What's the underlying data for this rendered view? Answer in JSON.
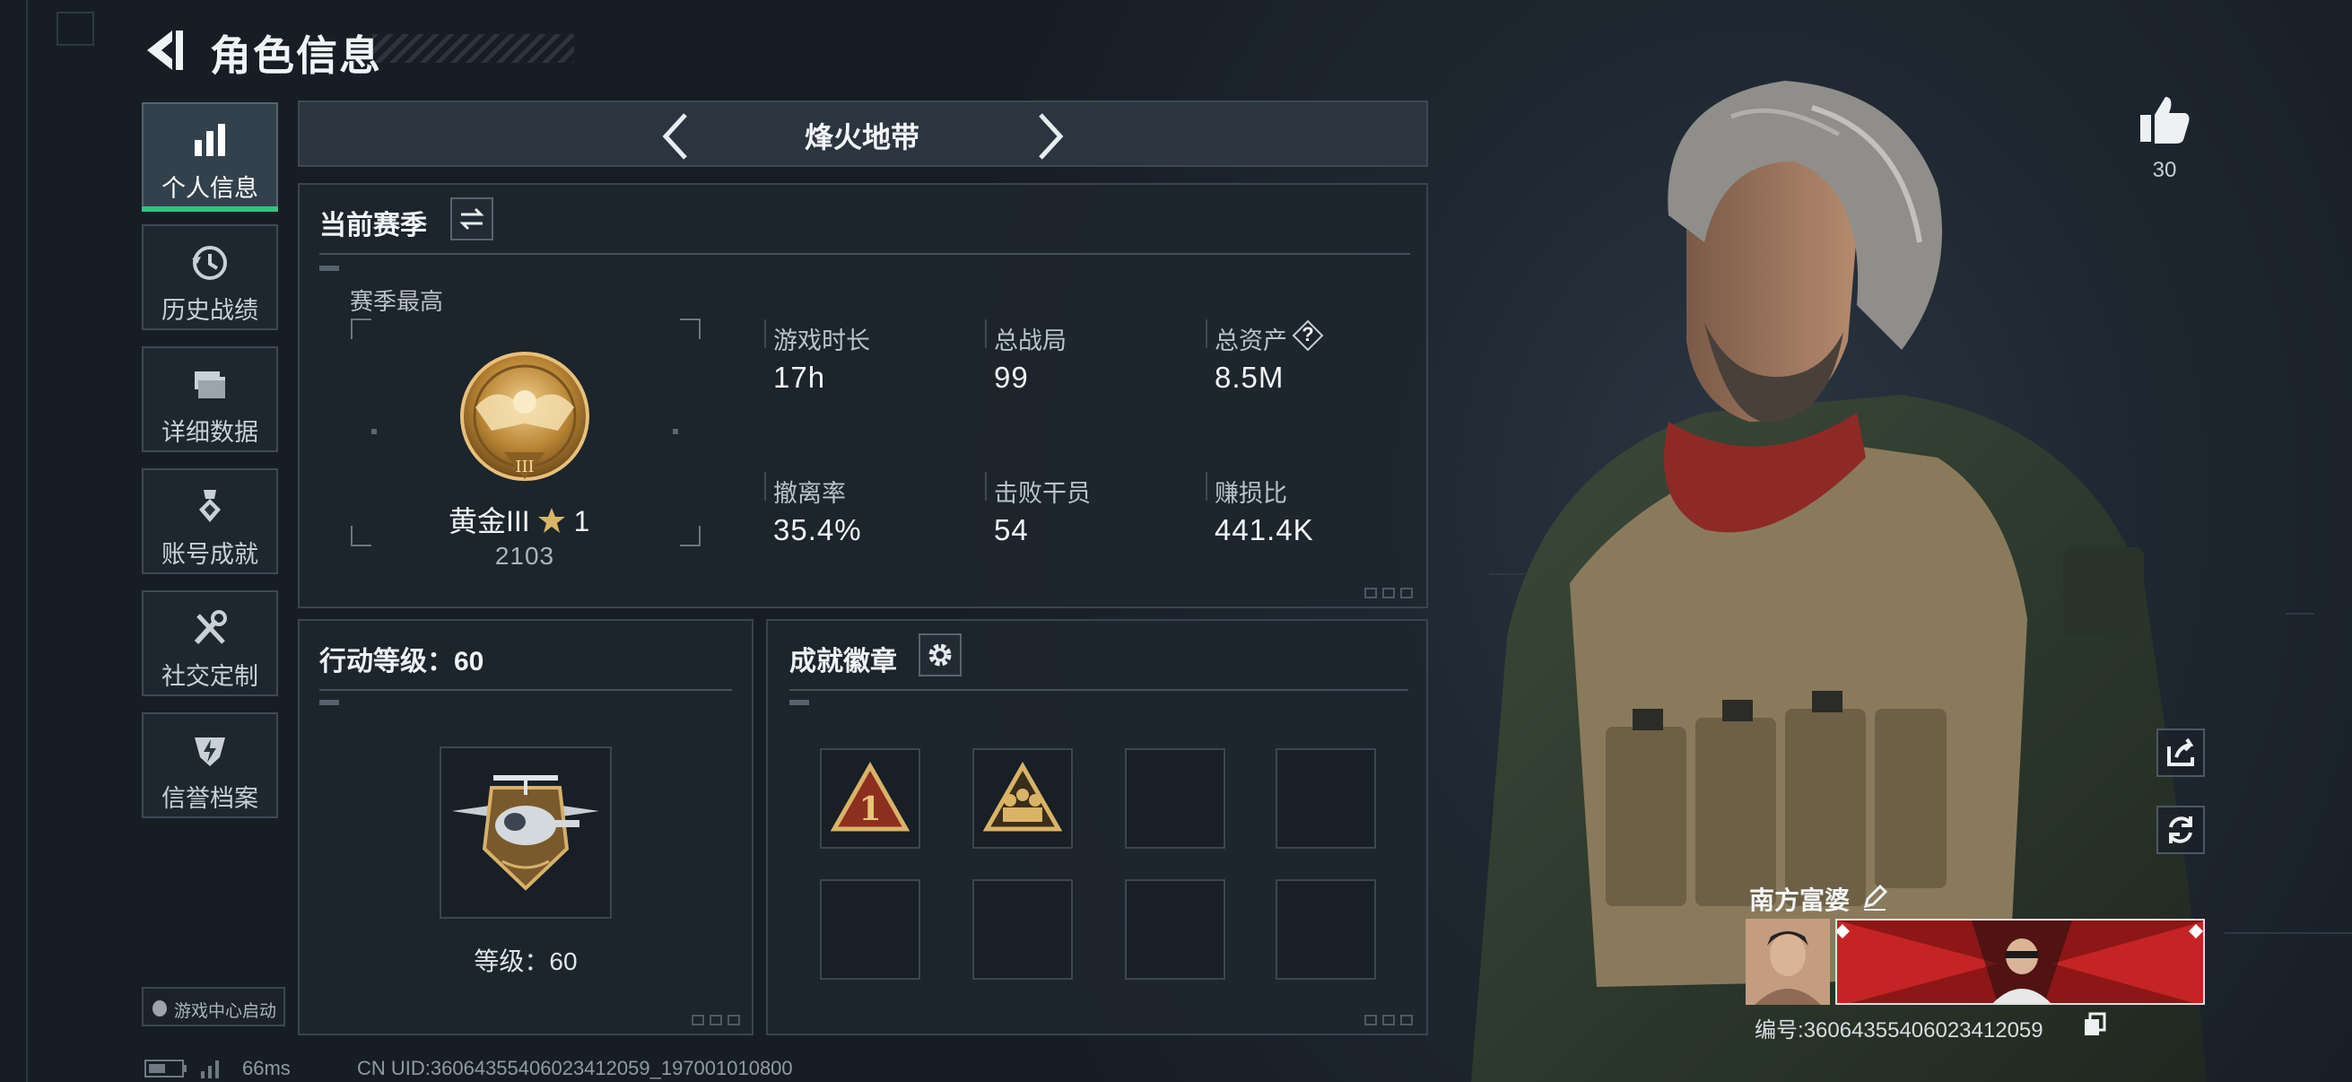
{
  "header": {
    "title": "角色信息",
    "back_icon": "back-arrow-icon"
  },
  "sidebar": {
    "items": [
      {
        "label": "个人信息",
        "icon": "bar-chart-icon",
        "active": true
      },
      {
        "label": "历史战绩",
        "icon": "history-clock-icon"
      },
      {
        "label": "详细数据",
        "icon": "folder-icon"
      },
      {
        "label": "账号成就",
        "icon": "medal-icon"
      },
      {
        "label": "社交定制",
        "icon": "tools-icon"
      },
      {
        "label": "信誉档案",
        "icon": "shield-bolt-icon"
      }
    ],
    "launcher_label": "游戏中心启动"
  },
  "mode_selector": {
    "title": "烽火地带",
    "prev_icon": "chevron-left-icon",
    "next_icon": "chevron-right-icon"
  },
  "season": {
    "title": "当前赛季",
    "switch_icon": "switch-arrows-icon",
    "best_label": "赛季最高",
    "rank_name": "黄金III",
    "rank_star_icon": "star-icon",
    "rank_stars": "1",
    "rank_points": "2103",
    "stats": [
      {
        "label": "游戏时长",
        "value": "17h"
      },
      {
        "label": "总战局",
        "value": "99"
      },
      {
        "label": "总资产",
        "value": "8.5M",
        "help": "?"
      },
      {
        "label": "撤离率",
        "value": "35.4%"
      },
      {
        "label": "击败干员",
        "value": "54"
      },
      {
        "label": "赚损比",
        "value": "441.4K"
      }
    ]
  },
  "action_level": {
    "title": "行动等级：60",
    "level_text": "等级：60"
  },
  "achievements": {
    "title": "成就徽章",
    "settings_icon": "gear-icon",
    "slots": 8,
    "filled": 2
  },
  "profile": {
    "likes_icon": "thumbs-up-icon",
    "likes": "30",
    "share_icon": "share-icon",
    "rotate_icon": "rotate-icon",
    "nickname": "南方富婆",
    "edit_icon": "pencil-icon",
    "id_text": "编号:36064355406023412059",
    "copy_icon": "copy-icon"
  },
  "status_bar": {
    "ping": "66ms",
    "uid": "CN UID:36064355406023412059_197001010800"
  },
  "colors": {
    "accent_green": "#2fc47e",
    "gold": "#c99a4b",
    "panel_border": "#3a4450"
  }
}
